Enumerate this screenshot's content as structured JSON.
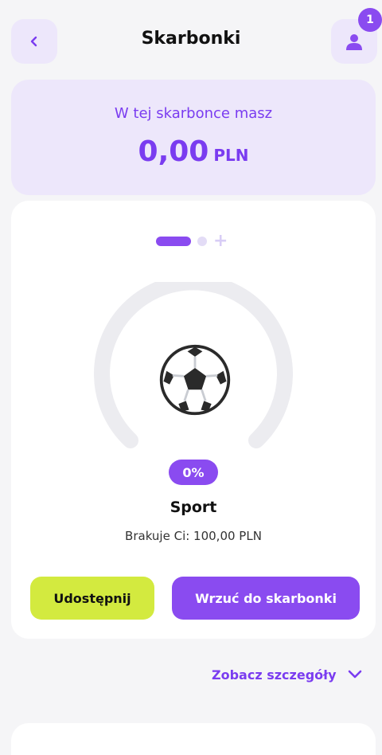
{
  "header": {
    "title": "Skarbonki",
    "back_icon": "chevron-left-icon",
    "profile_icon": "user-icon",
    "notification_count": "1"
  },
  "balance": {
    "label": "W tej skarbonce masz",
    "amount": "0,00",
    "currency": "PLN"
  },
  "pager": {
    "pages": 2,
    "active_index": 0,
    "add_icon": "plus-icon"
  },
  "goal": {
    "icon": "soccer-ball-icon",
    "progress_label": "0%",
    "progress_fraction": 0,
    "name": "Sport",
    "missing_text": "Brakuje Ci: 100,00 PLN"
  },
  "actions": {
    "share_label": "Udostępnij",
    "deposit_label": "Wrzuć do skarbonki"
  },
  "details": {
    "label": "Zobacz szczegóły",
    "icon": "chevron-down-icon"
  },
  "colors": {
    "accent": "#8a4bf0",
    "accent_light": "#ede7fb",
    "lime": "#d3ea3f",
    "background": "#f5f5f7"
  }
}
